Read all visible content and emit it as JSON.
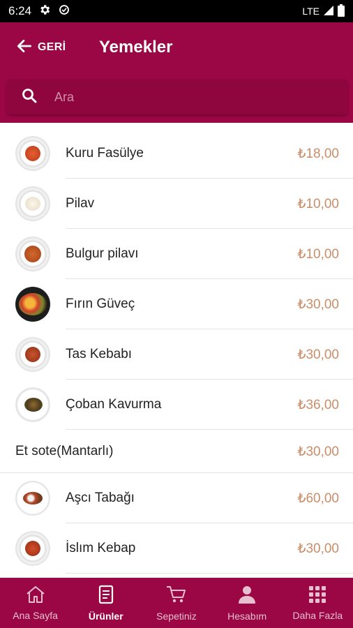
{
  "status_bar": {
    "time": "6:24",
    "network": "LTE"
  },
  "header": {
    "back_label": "GERİ",
    "title": "Yemekler"
  },
  "search": {
    "placeholder": "Ara",
    "value": ""
  },
  "items": [
    {
      "name": "Kuru Fasülye",
      "price": "₺18,00",
      "has_image": true
    },
    {
      "name": "Pilav",
      "price": "₺10,00",
      "has_image": true
    },
    {
      "name": "Bulgur pilavı",
      "price": "₺10,00",
      "has_image": true
    },
    {
      "name": "Fırın Güveç",
      "price": "₺30,00",
      "has_image": true
    },
    {
      "name": "Tas Kebabı",
      "price": "₺30,00",
      "has_image": true
    },
    {
      "name": "Çoban Kavurma",
      "price": "₺36,00",
      "has_image": true
    },
    {
      "name": "Et sote(Mantarlı)",
      "price": "₺30,00",
      "has_image": false
    },
    {
      "name": "Aşcı Tabağı",
      "price": "₺60,00",
      "has_image": true
    },
    {
      "name": "İslım Kebap",
      "price": "₺30,00",
      "has_image": true
    }
  ],
  "bottom_nav": [
    {
      "label": "Ana Sayfa",
      "icon": "home-icon",
      "active": false
    },
    {
      "label": "Ürünler",
      "icon": "menu-book-icon",
      "active": true
    },
    {
      "label": "Sepetiniz",
      "icon": "cart-icon",
      "active": false
    },
    {
      "label": "Hesabım",
      "icon": "person-icon",
      "active": false
    },
    {
      "label": "Daha Fazla",
      "icon": "grid-icon",
      "active": false
    }
  ],
  "colors": {
    "primary": "#9b0644",
    "price": "#c98d68",
    "text": "#222222",
    "divider": "#e3e3e3"
  }
}
